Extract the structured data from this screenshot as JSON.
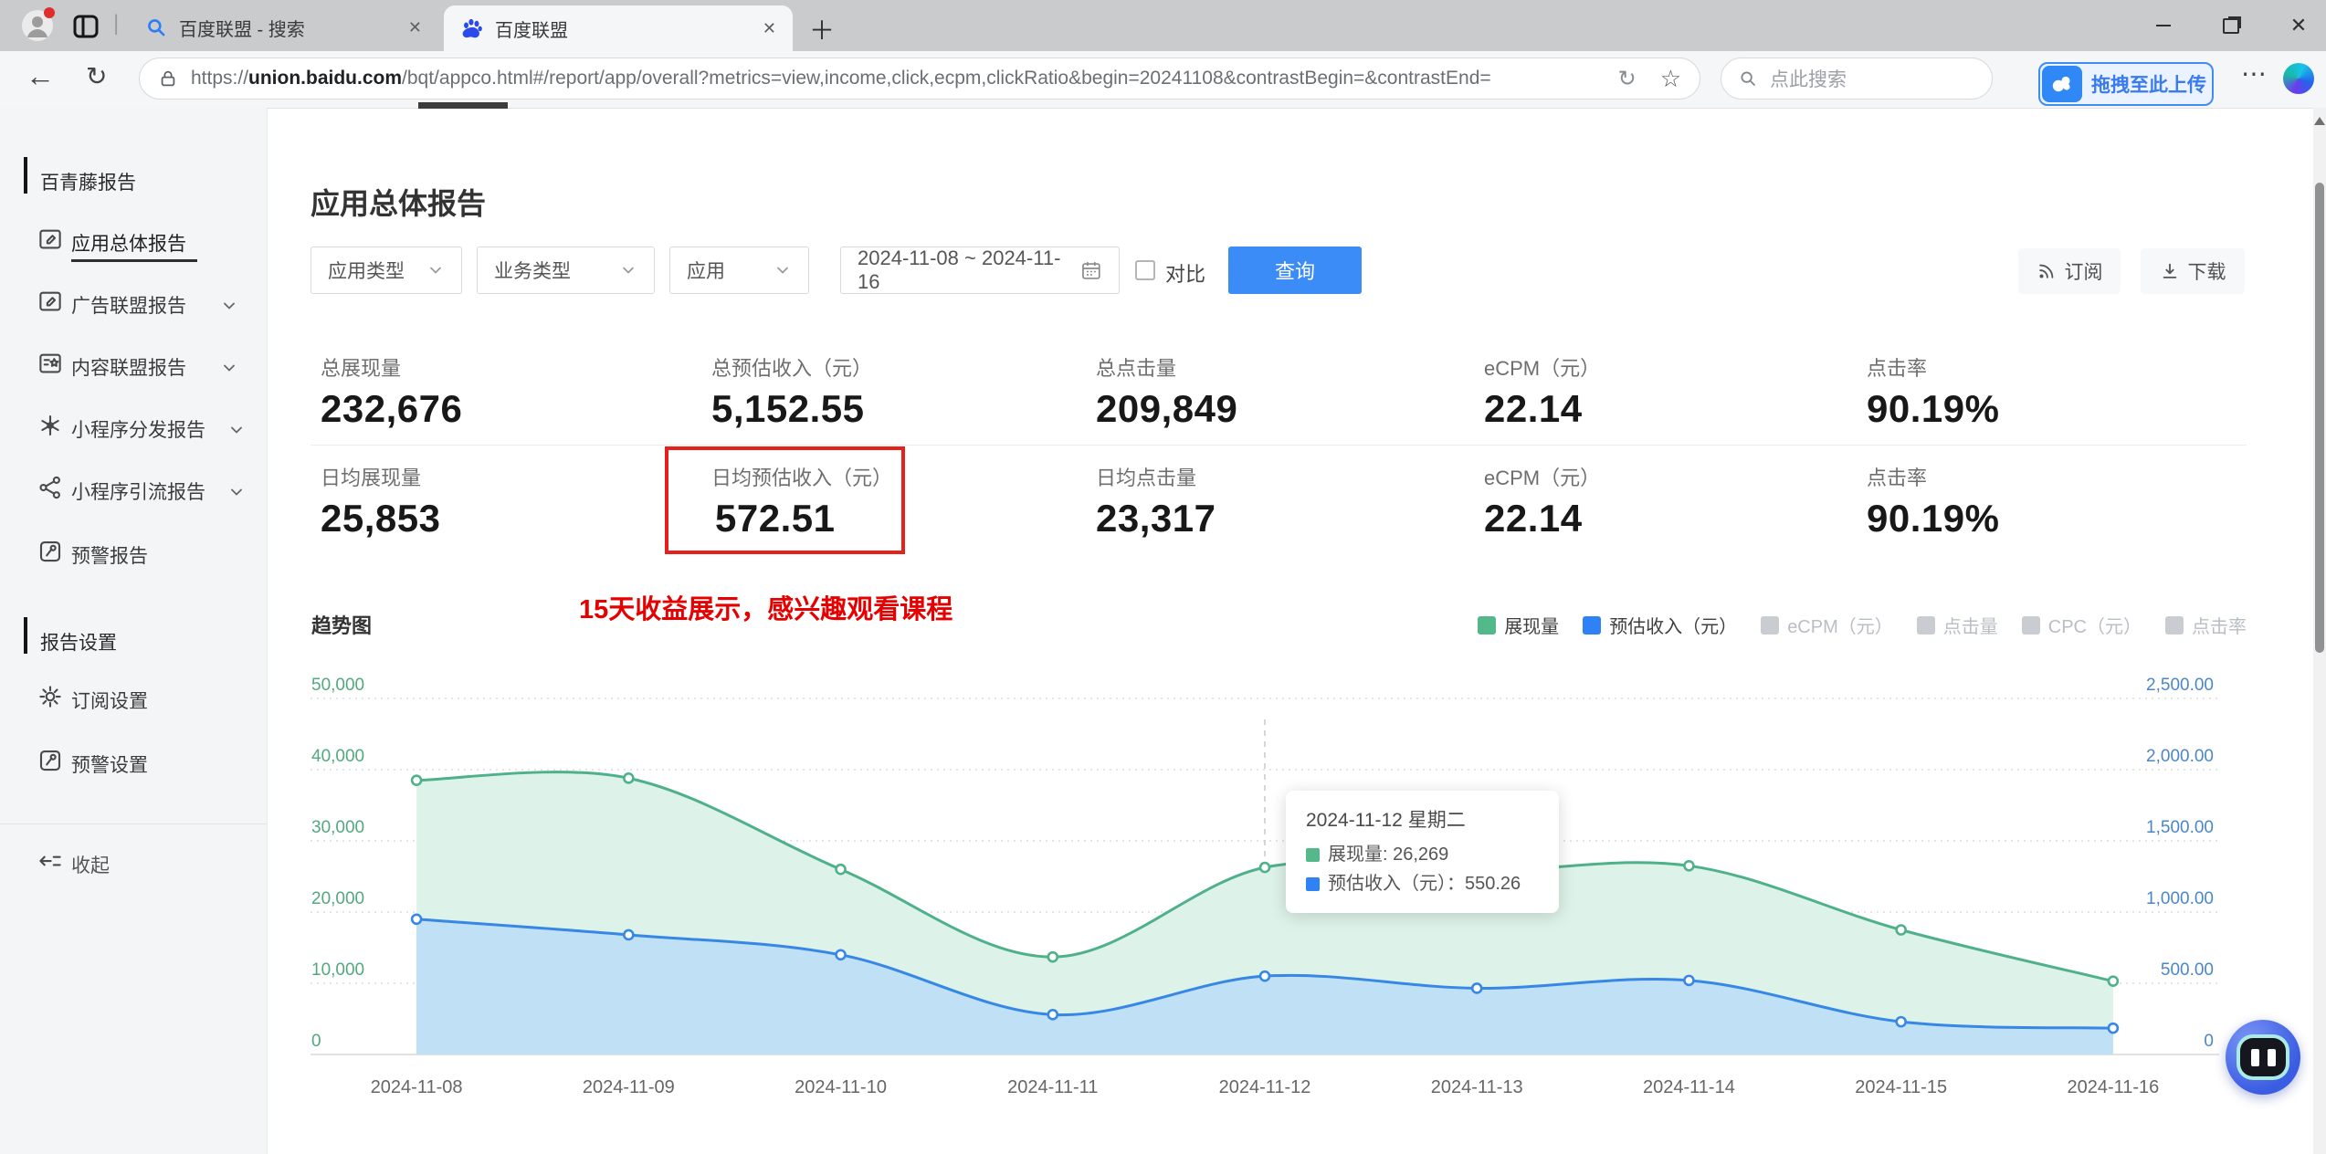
{
  "browser": {
    "tabs": [
      {
        "title": "百度联盟 - 搜索"
      },
      {
        "title": "百度联盟"
      }
    ],
    "url": {
      "scheme": "https://",
      "domain": "union.baidu.com",
      "path": "/bqt/appco.html#/report/app/overall?metrics=view,income,click,ecpm,clickRatio&begin=20241108&contrastBegin=&contrastEnd="
    },
    "search_placeholder": "点此搜索",
    "upload_button": "拖拽至此上传",
    "glyphs": {
      "back": "←",
      "reload": "↻",
      "url_reload": "↻",
      "star": "☆",
      "dots": "⋯",
      "plus": "＋",
      "close": "✕",
      "tab_close": "✕",
      "separator": "|"
    }
  },
  "sidebar": {
    "section1": "百青藤报告",
    "items": [
      {
        "label": "应用总体报告",
        "icon": "app-report-icon",
        "active": true
      },
      {
        "label": "广告联盟报告",
        "icon": "ad-report-icon",
        "expandable": true
      },
      {
        "label": "内容联盟报告",
        "icon": "content-report-icon",
        "expandable": true
      },
      {
        "label": "小程序分发报告",
        "icon": "mini-distribute-icon",
        "expandable": true
      },
      {
        "label": "小程序引流报告",
        "icon": "mini-traffic-icon",
        "expandable": true
      },
      {
        "label": "预警报告",
        "icon": "alert-report-icon"
      }
    ],
    "section2": "报告设置",
    "settings": [
      {
        "label": "订阅设置",
        "icon": "gear-icon"
      },
      {
        "label": "预警设置",
        "icon": "alert-report-icon"
      }
    ],
    "collapse": "收起"
  },
  "page": {
    "title": "应用总体报告"
  },
  "filters": {
    "app_type": "应用类型",
    "business_type": "业务类型",
    "app": "应用",
    "date_range": "2024-11-08 ~ 2024-11-16",
    "compare": "对比",
    "query": "查询",
    "subscribe": "订阅",
    "download": "下载"
  },
  "stats": {
    "rows": [
      {
        "cells": [
          {
            "label": "总展现量",
            "value": "232,676"
          },
          {
            "label": "总预估收入（元）",
            "value": "5,152.55"
          },
          {
            "label": "总点击量",
            "value": "209,849"
          },
          {
            "label": "eCPM（元）",
            "value": "22.14"
          },
          {
            "label": "点击率",
            "value": "90.19%"
          }
        ]
      },
      {
        "cells": [
          {
            "label": "日均展现量",
            "value": "25,853"
          },
          {
            "label": "日均预估收入（元）",
            "value": "572.51",
            "highlighted": true
          },
          {
            "label": "日均点击量",
            "value": "23,317"
          },
          {
            "label": "eCPM（元）",
            "value": "22.14"
          },
          {
            "label": "点击率",
            "value": "90.19%"
          }
        ]
      }
    ]
  },
  "annotation": {
    "text": "15天收益展示，感兴趣观看课程",
    "color": "#e60000"
  },
  "trend": {
    "title": "趋势图",
    "legend": [
      {
        "label": "展现量",
        "color": "#53b98b",
        "active": true
      },
      {
        "label": "预估收入（元）",
        "color": "#2f82f6",
        "active": true
      },
      {
        "label": "eCPM（元）",
        "color": "#c9cdd1",
        "active": false
      },
      {
        "label": "点击量",
        "color": "#c9cdd1",
        "active": false
      },
      {
        "label": "CPC（元）",
        "color": "#c9cdd1",
        "active": false
      },
      {
        "label": "点击率",
        "color": "#c9cdd1",
        "active": false
      }
    ]
  },
  "chart_data": {
    "type": "area",
    "title": "趋势图",
    "x": [
      "2024-11-08",
      "2024-11-09",
      "2024-11-10",
      "2024-11-11",
      "2024-11-12",
      "2024-11-13",
      "2024-11-14",
      "2024-11-15",
      "2024-11-16"
    ],
    "series": [
      {
        "name": "展现量",
        "axis": "left",
        "color": "#4fb189",
        "fill": "#ddf2e8",
        "values": [
          38500,
          38800,
          26000,
          13700,
          26269,
          25700,
          26500,
          17500,
          10300
        ]
      },
      {
        "name": "预估收入（元）",
        "axis": "right",
        "color": "#3787e6",
        "fill": "#bfe0f5",
        "values": [
          950,
          840,
          700,
          280,
          550.26,
          465,
          520,
          230,
          185
        ]
      }
    ],
    "ylim_left": [
      0,
      50000
    ],
    "ylim_right": [
      0,
      2500
    ],
    "yticks_left": [
      "0",
      "10,000",
      "20,000",
      "30,000",
      "40,000",
      "50,000"
    ],
    "yticks_right": [
      "0",
      "500.00",
      "1,000.00",
      "1,500.00",
      "2,000.00",
      "2,500.00"
    ],
    "grid": "dotted horizontal",
    "legend_position": "top-right",
    "smooth": true,
    "highlight_index": 4
  },
  "tooltip": {
    "title": "2024-11-12 星期二",
    "rows": [
      {
        "text": "展现量: 26,269",
        "color": "#53b98b"
      },
      {
        "text": "预估收入（元）：550.26",
        "color": "#2f82f6"
      }
    ]
  },
  "colors": {
    "accent_blue": "#3b8cf7",
    "green": "#53b98b",
    "blue": "#2f82f6",
    "red_box": "#e5211b",
    "tick_green": "#53a87f",
    "tick_blue": "#4b87c8"
  }
}
